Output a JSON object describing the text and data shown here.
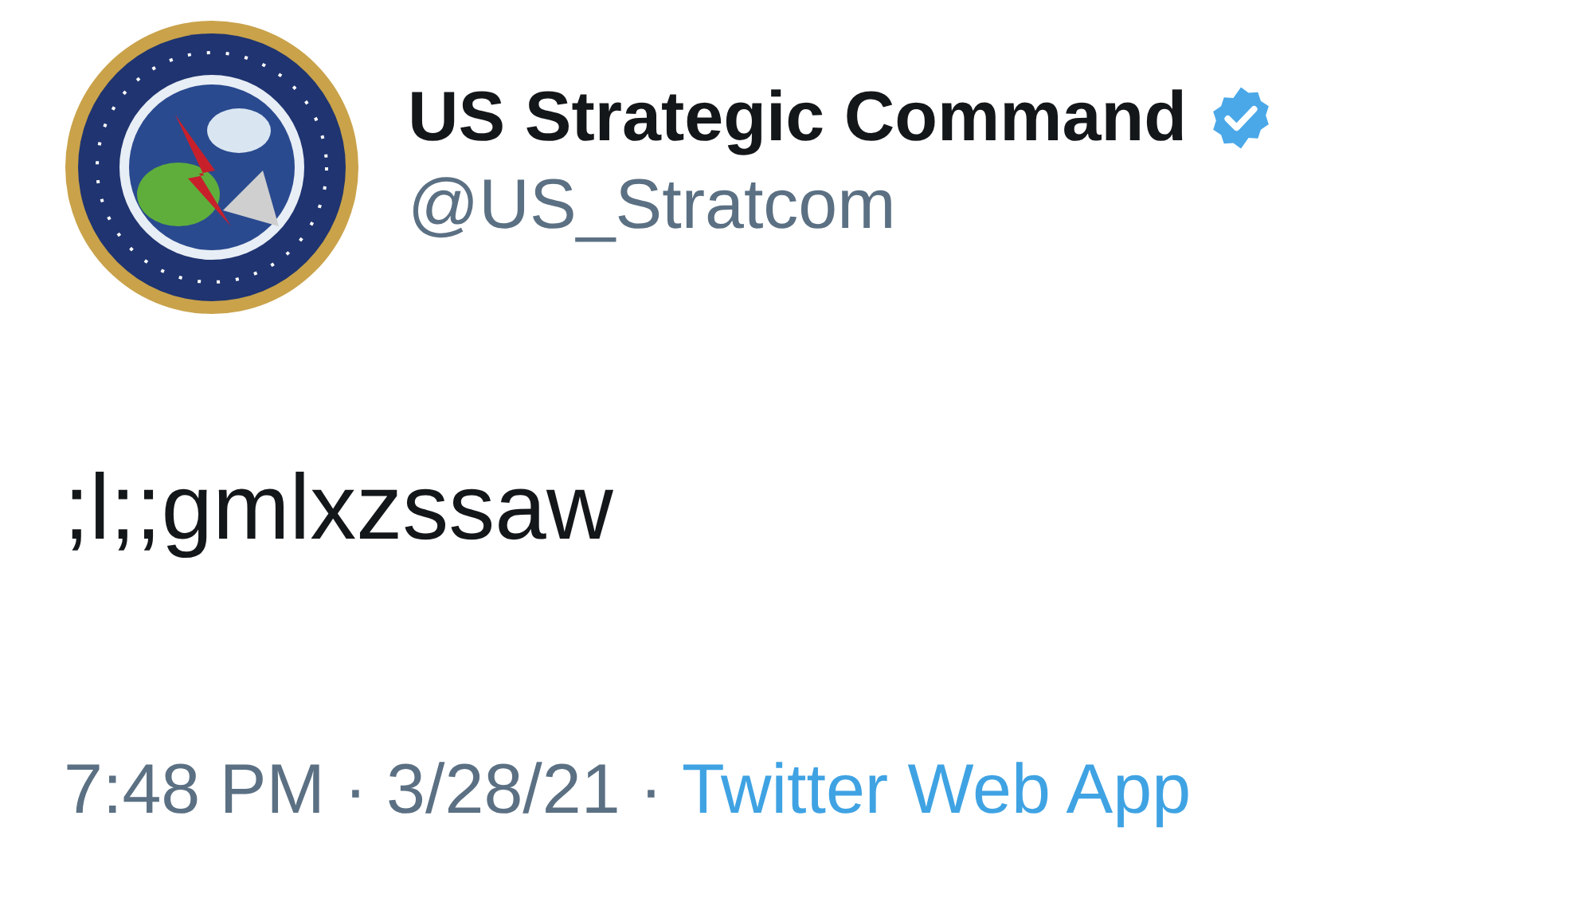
{
  "author": {
    "name": "US Strategic Command",
    "verified": true,
    "handle": "@US_Stratcom"
  },
  "tweet": {
    "text": ";l;;gmlxzssaw"
  },
  "footer": [
    {
      "kind": "time",
      "text": "7:48 PM"
    },
    {
      "kind": "separator",
      "text": "·"
    },
    {
      "kind": "date",
      "text": "3/28/21"
    },
    {
      "kind": "separator",
      "text": "·"
    },
    {
      "kind": "link",
      "text": "Twitter Web App"
    }
  ]
}
